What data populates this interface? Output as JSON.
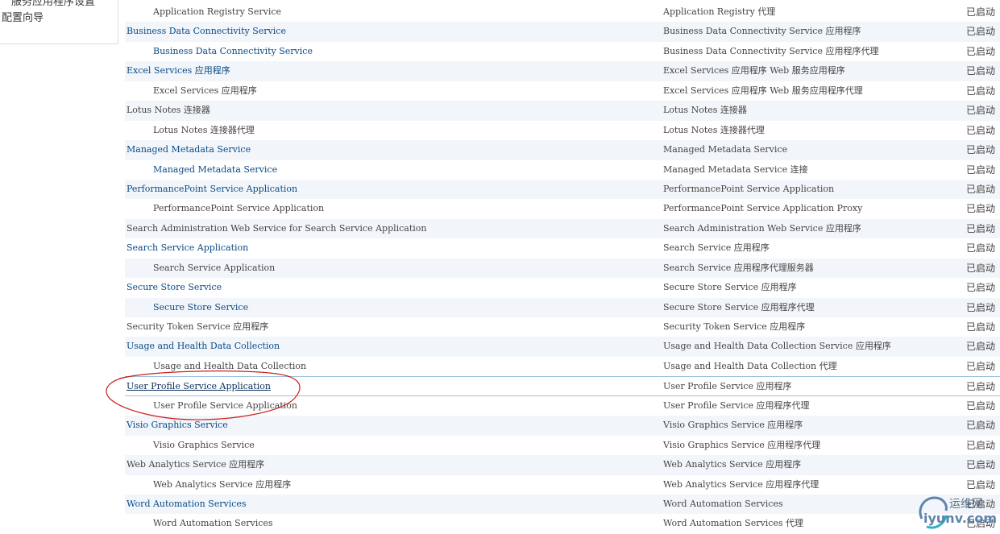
{
  "left_nav": {
    "cut_item": "服务应用程序设置",
    "item": "配置向导"
  },
  "rows": [
    {
      "name": "Application Registry Service",
      "type": "Application Registry 代理",
      "status": "已启动",
      "child": true,
      "link": false,
      "alt": false
    },
    {
      "name": "Business Data Connectivity Service",
      "type": "Business Data Connectivity Service 应用程序",
      "status": "已启动",
      "child": false,
      "link": true,
      "alt": true
    },
    {
      "name": "Business Data Connectivity Service",
      "type": "Business Data Connectivity Service 应用程序代理",
      "status": "已启动",
      "child": true,
      "link": true,
      "alt": false
    },
    {
      "name": "Excel Services 应用程序",
      "type": "Excel Services 应用程序 Web 服务应用程序",
      "status": "已启动",
      "child": false,
      "link": true,
      "alt": true
    },
    {
      "name": "Excel Services 应用程序",
      "type": "Excel Services 应用程序 Web 服务应用程序代理",
      "status": "已启动",
      "child": true,
      "link": false,
      "alt": false
    },
    {
      "name": "Lotus Notes 连接器",
      "type": "Lotus Notes 连接器",
      "status": "已启动",
      "child": false,
      "link": false,
      "alt": true
    },
    {
      "name": "Lotus Notes 连接器代理",
      "type": "Lotus Notes 连接器代理",
      "status": "已启动",
      "child": true,
      "link": false,
      "alt": false
    },
    {
      "name": "Managed Metadata Service",
      "type": "Managed Metadata Service",
      "status": "已启动",
      "child": false,
      "link": true,
      "alt": true
    },
    {
      "name": "Managed Metadata Service",
      "type": "Managed Metadata Service 连接",
      "status": "已启动",
      "child": true,
      "link": true,
      "alt": false
    },
    {
      "name": "PerformancePoint Service Application",
      "type": "PerformancePoint Service Application",
      "status": "已启动",
      "child": false,
      "link": true,
      "alt": true
    },
    {
      "name": "PerformancePoint Service Application",
      "type": "PerformancePoint Service Application Proxy",
      "status": "已启动",
      "child": true,
      "link": false,
      "alt": false
    },
    {
      "name": "Search Administration Web Service for Search Service Application",
      "type": "Search Administration Web Service 应用程序",
      "status": "已启动",
      "child": false,
      "link": false,
      "alt": true
    },
    {
      "name": "Search Service Application",
      "type": "Search Service 应用程序",
      "status": "已启动",
      "child": false,
      "link": true,
      "alt": false
    },
    {
      "name": "Search Service Application",
      "type": "Search Service 应用程序代理服务器",
      "status": "已启动",
      "child": true,
      "link": false,
      "alt": true
    },
    {
      "name": "Secure Store Service",
      "type": "Secure Store Service 应用程序",
      "status": "已启动",
      "child": false,
      "link": true,
      "alt": false
    },
    {
      "name": "Secure Store Service",
      "type": "Secure Store Service 应用程序代理",
      "status": "已启动",
      "child": true,
      "link": true,
      "alt": true
    },
    {
      "name": "Security Token Service 应用程序",
      "type": "Security Token Service 应用程序",
      "status": "已启动",
      "child": false,
      "link": false,
      "alt": false
    },
    {
      "name": "Usage and Health Data Collection",
      "type": "Usage and Health Data Collection Service 应用程序",
      "status": "已启动",
      "child": false,
      "link": true,
      "alt": true
    },
    {
      "name": "Usage and Health Data Collection",
      "type": "Usage and Health Data Collection 代理",
      "status": "已启动",
      "child": true,
      "link": false,
      "alt": false
    },
    {
      "name": "User Profile Service Application",
      "type": "User Profile Service 应用程序",
      "status": "已启动",
      "child": false,
      "link": true,
      "alt": false,
      "selected": true
    },
    {
      "name": "User Profile Service Application",
      "type": "User Profile Service 应用程序代理",
      "status": "已启动",
      "child": true,
      "link": false,
      "alt": false
    },
    {
      "name": "Visio Graphics Service",
      "type": "Visio Graphics Service 应用程序",
      "status": "已启动",
      "child": false,
      "link": true,
      "alt": true
    },
    {
      "name": "Visio Graphics Service",
      "type": "Visio Graphics Service 应用程序代理",
      "status": "已启动",
      "child": true,
      "link": false,
      "alt": false
    },
    {
      "name": "Web Analytics Service 应用程序",
      "type": "Web Analytics Service 应用程序",
      "status": "已启动",
      "child": false,
      "link": false,
      "alt": true
    },
    {
      "name": "Web Analytics Service 应用程序",
      "type": "Web Analytics Service 应用程序代理",
      "status": "已启动",
      "child": true,
      "link": false,
      "alt": false
    },
    {
      "name": "Word Automation Services",
      "type": "Word Automation Services",
      "status": "已启动",
      "child": false,
      "link": true,
      "alt": true
    },
    {
      "name": "Word Automation Services",
      "type": "Word Automation Services 代理",
      "status": "已启动",
      "child": true,
      "link": false,
      "alt": false
    }
  ],
  "watermark": {
    "line1": "运维网",
    "line2": "iyunv.com"
  },
  "colors": {
    "link": "#0a4a86",
    "text": "#444444",
    "alt_row": "#f2f6fa",
    "annotation": "#cc2020"
  }
}
